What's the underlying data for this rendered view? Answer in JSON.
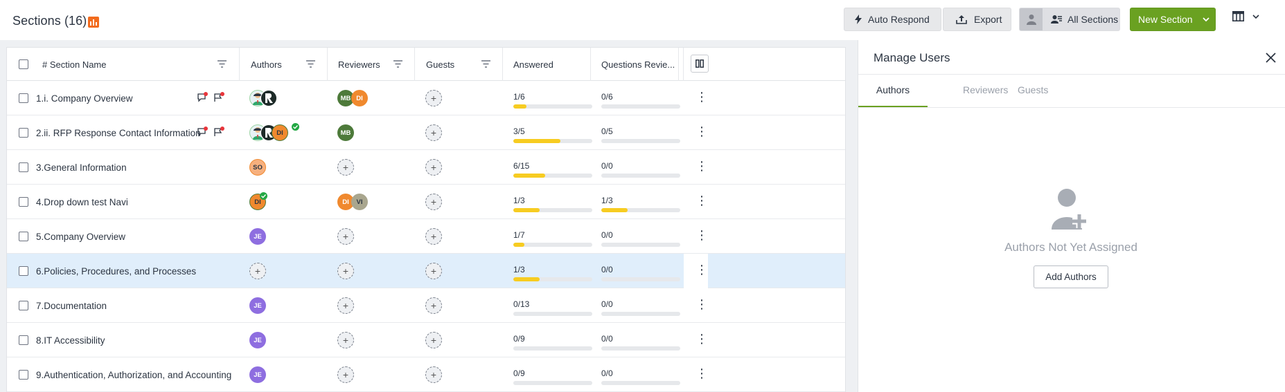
{
  "header": {
    "title": "Sections (16)",
    "buttons": {
      "auto_respond": "Auto Respond",
      "export": "Export",
      "all_sections": "All Sections",
      "new_section": "New Section"
    }
  },
  "colors": {
    "accent_green": "#6aa121",
    "progress_yellow": "#f7cc21",
    "selected_row": "#e0eefb",
    "reviewer_flag": "#8a3bf2"
  },
  "table": {
    "columns": {
      "section_name": "# Section Name",
      "authors": "Authors",
      "reviewers": "Reviewers",
      "guests": "Guests",
      "answered": "Answered",
      "questions_reviewed": "Questions Revie..."
    },
    "rows": [
      {
        "num": "1.",
        "name": "i. Company Overview",
        "answered": "1/6",
        "answered_pct": 16.7,
        "reviewed": "0/6",
        "reviewed_pct": 0
      },
      {
        "num": "2.",
        "name": "ii. RFP Response Contact Information",
        "answered": "3/5",
        "answered_pct": 60,
        "reviewed": "0/5",
        "reviewed_pct": 0
      },
      {
        "num": "3.",
        "name": "General Information",
        "answered": "6/15",
        "answered_pct": 40,
        "reviewed": "0/0",
        "reviewed_pct": 0
      },
      {
        "num": "4.",
        "name": "Drop down test Navi",
        "answered": "1/3",
        "answered_pct": 33.3,
        "reviewed": "1/3",
        "reviewed_pct": 33.3
      },
      {
        "num": "5.",
        "name": "Company Overview",
        "answered": "1/7",
        "answered_pct": 14.3,
        "reviewed": "0/0",
        "reviewed_pct": 0
      },
      {
        "num": "6.",
        "name": "Policies, Procedures, and Processes",
        "answered": "1/3",
        "answered_pct": 33.3,
        "reviewed": "0/0",
        "reviewed_pct": 0
      },
      {
        "num": "7.",
        "name": "Documentation",
        "answered": "0/13",
        "answered_pct": 0,
        "reviewed": "0/0",
        "reviewed_pct": 0
      },
      {
        "num": "8.",
        "name": "IT Accessibility",
        "answered": "0/9",
        "answered_pct": 0,
        "reviewed": "0/0",
        "reviewed_pct": 0
      },
      {
        "num": "9.",
        "name": "Authentication, Authorization, and Accounting",
        "answered": "0/9",
        "answered_pct": 0,
        "reviewed": "0/0",
        "reviewed_pct": 0
      }
    ],
    "avatars": {
      "mb": "MB",
      "di": "DI",
      "so": "SO",
      "je": "JE",
      "vi": "VI"
    }
  },
  "panel": {
    "title": "Manage Users",
    "tabs": {
      "authors": "Authors",
      "reviewers": "Reviewers",
      "guests": "Guests"
    },
    "empty_text": "Authors Not Yet Assigned",
    "add_button": "Add Authors"
  }
}
